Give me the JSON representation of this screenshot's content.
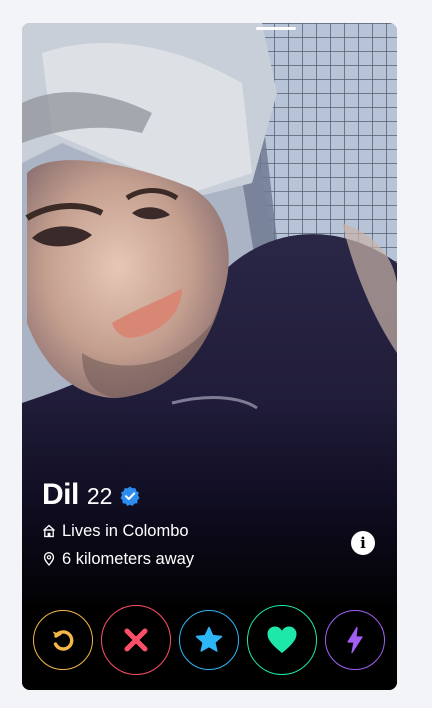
{
  "profile": {
    "name": "Dil",
    "age": "22",
    "verified": true,
    "location": "Lives in Colombo",
    "distance": "6 kilometers away",
    "photo_count": 1
  },
  "icons": {
    "verified": "verified-badge-icon",
    "location": "house-icon",
    "distance": "pin-icon",
    "info": "info-icon",
    "rewind": "rewind-icon",
    "nope": "x-icon",
    "super_like": "star-icon",
    "like": "heart-icon",
    "boost": "lightning-icon"
  },
  "colors": {
    "rewind": "#f5b748",
    "nope": "#fd5068",
    "super_like": "#2db6f5",
    "like": "#1ee8a9",
    "boost": "#a35ff5",
    "verified": "#2d8cf0"
  }
}
